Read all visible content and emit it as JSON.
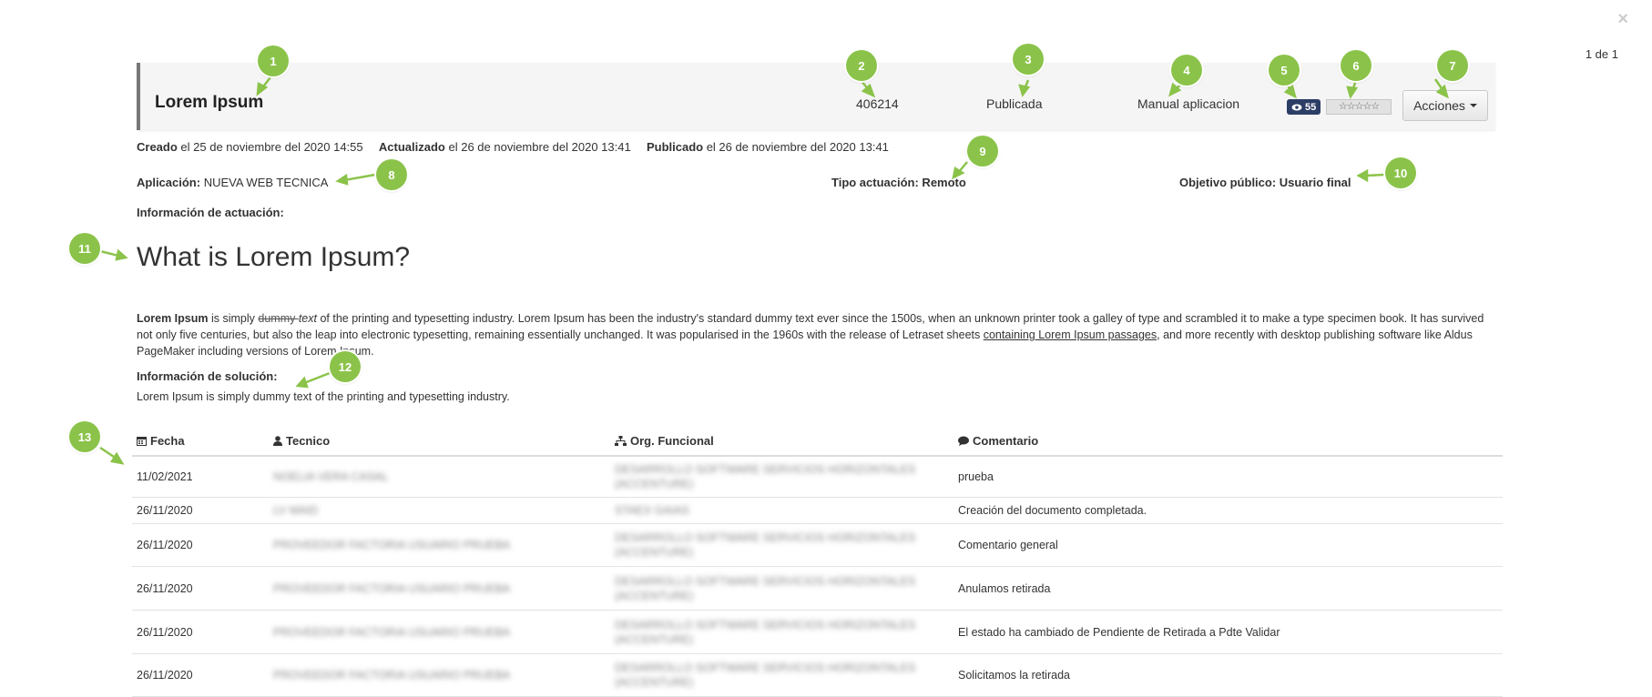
{
  "window": {
    "close_glyph": "×",
    "pager": "1 de 1"
  },
  "header": {
    "title": "Lorem Ipsum",
    "id": "406214",
    "status": "Publicada",
    "type": "Manual aplicacion",
    "views": "55",
    "rating_stars": "☆☆☆☆☆",
    "actions_label": "Acciones"
  },
  "meta": {
    "created_label": "Creado",
    "created_text": "el 25 de noviembre del 2020 14:55",
    "updated_label": "Actualizado",
    "updated_text": "el 26 de noviembre del 2020 13:41",
    "published_label": "Publicado",
    "published_text": "el 26 de noviembre del 2020 13:41"
  },
  "fields": {
    "app_label": "Aplicación:",
    "app_value": "NUEVA WEB TECNICA",
    "tipo": "Tipo actuación: Remoto",
    "objetivo": "Objetivo público: Usuario final",
    "info_actuacion_label": "Información de actuación:"
  },
  "article": {
    "heading": "What is Lorem Ipsum?",
    "bold_lead": "Lorem Ipsum",
    "text_1": " is simply ",
    "strike": "dummy ",
    "italic": "text",
    "text_2": " of the printing and typesetting industry. Lorem Ipsum has been the industry's standard dummy text ever since the 1500s, when an unknown printer took a galley of type and scrambled it to make a type specimen book. It has survived not only five centuries, but also the leap into electronic typesetting, remaining essentially unchanged. It was popularised in the 1960s with the release of Letraset sheets ",
    "link": "containing Lorem Ipsum passages",
    "text_3": ", and more recently with desktop publishing software like Aldus PageMaker including versions of Lorem Ipsum."
  },
  "solution": {
    "label": "Información de solución:",
    "text": "Lorem Ipsum is simply dummy text of the printing and typesetting industry."
  },
  "table": {
    "headers": {
      "fecha": "Fecha",
      "tecnico": "Tecnico",
      "org": "Org. Funcional",
      "comentario": "Comentario"
    },
    "rows": [
      {
        "fecha": "11/02/2021",
        "tecnico": "NOELIA VERA CASAL",
        "org": "DESARROLLO SOFTWARE SERVICIOS HORIZONTALES (ACCENTURE)",
        "comentario": "prueba"
      },
      {
        "fecha": "26/11/2020",
        "tecnico": "LV MAID",
        "org": "STAEX GAIAS",
        "comentario": "Creación del documento completada."
      },
      {
        "fecha": "26/11/2020",
        "tecnico": "PROVEEDOR FACTORIA USUARIO PRUEBA",
        "org": "DESARROLLO SOFTWARE SERVICIOS HORIZONTALES (ACCENTURE)",
        "comentario": "Comentario general"
      },
      {
        "fecha": "26/11/2020",
        "tecnico": "PROVEEDOR FACTORIA USUARIO PRUEBA",
        "org": "DESARROLLO SOFTWARE SERVICIOS HORIZONTALES (ACCENTURE)",
        "comentario": "Anulamos retirada"
      },
      {
        "fecha": "26/11/2020",
        "tecnico": "PROVEEDOR FACTORIA USUARIO PRUEBA",
        "org": "DESARROLLO SOFTWARE SERVICIOS HORIZONTALES (ACCENTURE)",
        "comentario": "El estado ha cambiado de Pendiente de Retirada a Pdte Validar"
      },
      {
        "fecha": "26/11/2020",
        "tecnico": "PROVEEDOR FACTORIA USUARIO PRUEBA",
        "org": "DESARROLLO SOFTWARE SERVICIOS HORIZONTALES (ACCENTURE)",
        "comentario": "Solicitamos la retirada"
      }
    ]
  },
  "callouts": [
    "1",
    "2",
    "3",
    "4",
    "5",
    "6",
    "7",
    "8",
    "9",
    "10",
    "11",
    "12",
    "13"
  ],
  "colors": {
    "callout": "#8bc34a",
    "badge": "#2c3e66",
    "header_accent": "#777777"
  },
  "icons": {
    "close": "close-icon",
    "views": "eye-icon",
    "caret": "caret-down-icon",
    "fecha": "calendar-icon",
    "tecnico": "user-icon",
    "org": "sitemap-icon",
    "comentario": "comment-icon"
  }
}
